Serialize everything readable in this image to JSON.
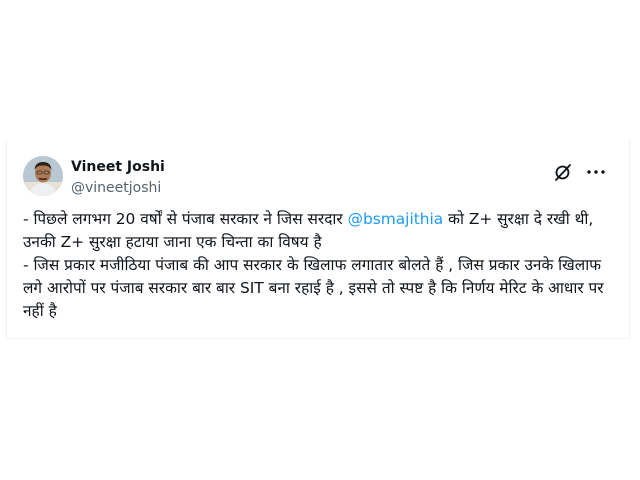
{
  "author": {
    "name": "Vineet Joshi",
    "handle": "@vineetjoshi"
  },
  "icons": [
    "avatar",
    "grok-icon",
    "more-icon"
  ],
  "tweet": {
    "line1_before": "- पिछले लगभग 20 वर्षों से पंजाब सरकार ने जिस सरदार ",
    "mention": "@bsmajithia",
    "line1_after": " को Z+ सुरक्षा दे रखी थी, उनकी Z+ सुरक्षा हटाया जाना एक चिन्ता का विषय है",
    "line2": "-  जिस प्रकार मजीठिया पंजाब की आप सरकार के खिलाफ लगातार बोलते हैं , जिस प्रकार उनके खिलाफ लगे आरोपों पर पंजाब सरकार बार बार SIT बना रहाई है , इससे तो स्पष्ट है कि निर्णय मेरिट के आधार पर नहीं है"
  },
  "colors": {
    "text": "#0f1419",
    "secondary": "#536471",
    "mention": "#1d9bf0",
    "border": "#eff3f4"
  }
}
